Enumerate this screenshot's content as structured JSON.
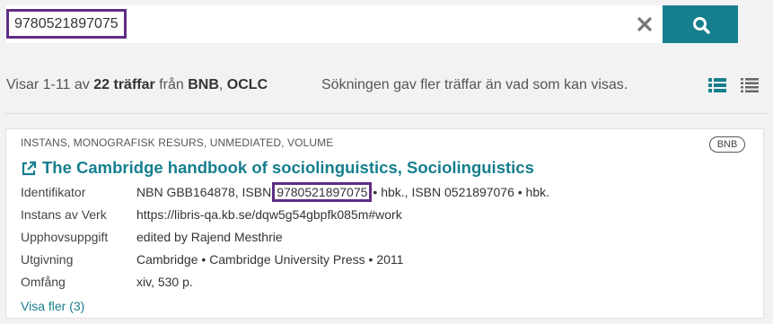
{
  "search": {
    "value": "9780521897075",
    "clear_icon": "close-icon",
    "search_icon": "search-icon",
    "accent_color": "#167f8e",
    "highlight_color": "#5e2d86"
  },
  "summary": {
    "prefix": "Visar 1-11 av",
    "total": "22 träffar",
    "from": "från",
    "source1": "BNB",
    "sep": ",",
    "source2": "OCLC",
    "note": "Sökningen gav fler träffar än vad som kan visas."
  },
  "views": [
    "list-view-icon",
    "compact-list-icon"
  ],
  "result": {
    "type": "INSTANS, MONOGRAFISK RESURS, UNMEDIATED, VOLUME",
    "source_badge": "BNB",
    "title": "The Cambridge handbook of sociolinguistics, Sociolinguistics",
    "properties": [
      {
        "label": "Identifikator",
        "pre": "NBN GBB164878, ISBN",
        "highlight": "9780521897075",
        "post": "• hbk., ISBN 0521897076 • hbk."
      },
      {
        "label": "Instans av Verk",
        "value": "https://libris-qa.kb.se/dqw5g54gbpfk085m#work"
      },
      {
        "label": "Upphovsuppgift",
        "value": "edited by Rajend Mesthrie"
      },
      {
        "label": "Utgivning",
        "value": "Cambridge • Cambridge University Press • 2011"
      },
      {
        "label": "Omfång",
        "value": "xiv, 530 p."
      }
    ],
    "more": "Visa fler (3)"
  }
}
